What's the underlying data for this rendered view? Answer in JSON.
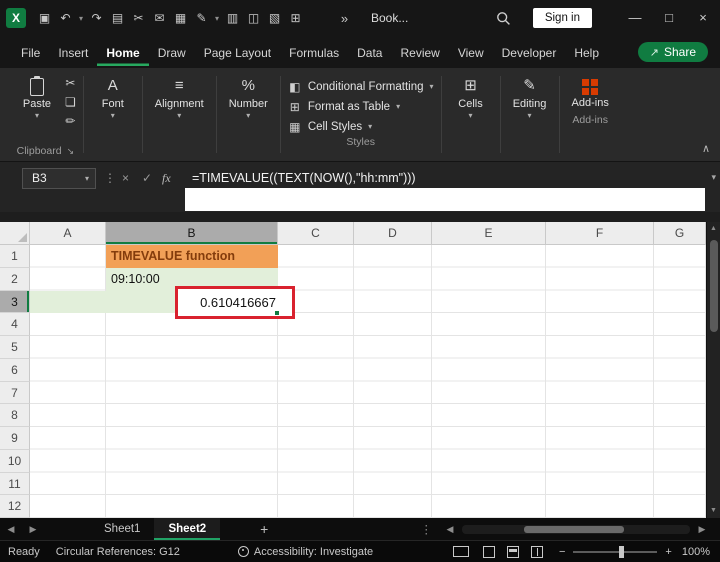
{
  "titlebar": {
    "document_title": "Book...",
    "sign_in": "Sign in"
  },
  "menu": {
    "tabs": [
      "File",
      "Insert",
      "Home",
      "Draw",
      "Page Layout",
      "Formulas",
      "Data",
      "Review",
      "View",
      "Developer",
      "Help"
    ],
    "active_tab": "Home",
    "share": "Share"
  },
  "ribbon": {
    "paste": "Paste",
    "clipboard_group": "Clipboard",
    "font": "Font",
    "alignment": "Alignment",
    "number": "Number",
    "conditional_formatting": "Conditional Formatting",
    "format_as_table": "Format as Table",
    "cell_styles": "Cell Styles",
    "styles_group": "Styles",
    "cells": "Cells",
    "editing": "Editing",
    "addins": "Add-ins",
    "addins_group": "Add-ins"
  },
  "formula_bar": {
    "name_box": "B3",
    "formula": "=TIMEVALUE((TEXT(NOW(),\"hh:mm\")))"
  },
  "grid": {
    "columns": [
      "A",
      "B",
      "C",
      "D",
      "E",
      "F",
      "G"
    ],
    "rows": [
      "1",
      "2",
      "3",
      "4",
      "5",
      "6",
      "7",
      "8",
      "9",
      "10",
      "11",
      "12"
    ],
    "cells": {
      "B1": "TIMEVALUE function",
      "B2": "09:10:00",
      "B3": "0.610416667"
    },
    "selection": {
      "active_cell": "B3",
      "column": "B",
      "row": "3"
    }
  },
  "sheet_tabs": {
    "sheet1": "Sheet1",
    "sheet2": "Sheet2",
    "active": "Sheet2",
    "add": "+"
  },
  "status_bar": {
    "ready": "Ready",
    "circular_references": "Circular References: G12",
    "accessibility": "Accessibility: Investigate",
    "zoom_level": "100%"
  },
  "colors": {
    "excel_green": "#107C41",
    "tab_underline": "#21A366",
    "orange_fill": "#F2A057",
    "orange_text": "#843C0C",
    "green_fill": "#E2EFDA",
    "annotation_red": "#D9222E",
    "addins_orange": "#D83B01"
  },
  "glyphs": {
    "excel_logo": "X",
    "save": "▣",
    "undo": "↶",
    "redo": "↷",
    "book": "▤",
    "cut": "✂",
    "mail": "✉",
    "chart": "▦",
    "pencil": "✎",
    "print": "▥",
    "clipboard": "◫",
    "camera": "▧",
    "table": "⊞",
    "more": "»",
    "chevron_down": "▾",
    "chevron_up": "∧",
    "dots_vertical": "⋮",
    "cancel": "×",
    "check": "✓",
    "fx": "fx",
    "minimize": "—",
    "maximize": "□",
    "close": "×",
    "share_arrow": "↗",
    "left": "◀",
    "right": "▶",
    "up": "▲",
    "down": "▼",
    "plus": "+",
    "minus": "−",
    "font_a": "A",
    "align": "≡",
    "percent": "%",
    "cond_format": "◧",
    "cell_styles_icon": "▦",
    "cells_icon": "⊞",
    "editing_icon": "✎",
    "copy": "❏",
    "format_painter": "✏",
    "dialog_launcher": "↘"
  }
}
